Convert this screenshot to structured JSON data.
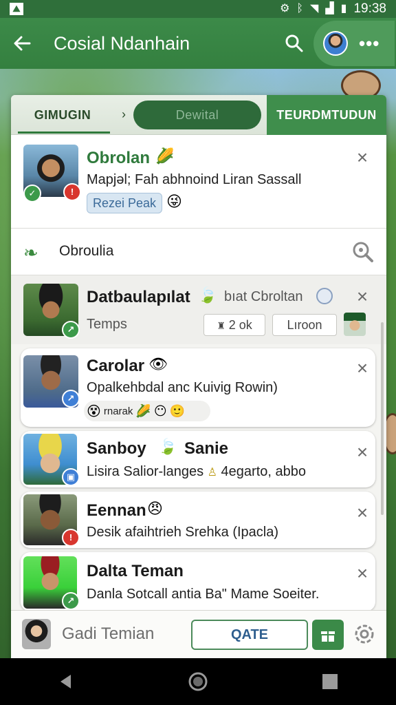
{
  "status_bar": {
    "time": "19:38"
  },
  "app_bar": {
    "title": "Cosial Ndanhain"
  },
  "tabs": [
    {
      "label": "GIMUGIN"
    },
    {
      "label": "Dewital"
    },
    {
      "label": "TEURDMTUDUN"
    }
  ],
  "featured": {
    "name": "Obrolan",
    "message": "Mapjəl; Fah abhnoind Liran Sassall",
    "chip": "Rezei Peak"
  },
  "search": {
    "query": "Obroulia"
  },
  "threads": [
    {
      "name": "Datbaulapılat",
      "subtitle": "bıat Cbroltan",
      "line": "Temps",
      "chip1": "2 ok",
      "chip2": "Lıroon"
    },
    {
      "name": "Carolar",
      "line": "Opalkehbdal anc Kuivig Rowin)",
      "sticker": "rnarak"
    },
    {
      "name": "Sanboy",
      "name2": "Sanie",
      "line": "Lisira Salior-langes",
      "line_tail": "4egarto, abbo"
    },
    {
      "name": "Eennan",
      "line": "Desik afaihtrieh Srehka (Ipacla)"
    },
    {
      "name": "Dalta Teman",
      "line": "Danla Sotcall antia Ba\" Mame Soeiter."
    }
  ],
  "bottom": {
    "hint": "Gadi Temian",
    "create_label": "QATE"
  },
  "colors": {
    "primary_green": "#3c8a49",
    "dark_green": "#2e6a3a",
    "badge_red": "#d8362e",
    "badge_green": "#3c9a4a",
    "badge_blue": "#3f7fd6"
  }
}
